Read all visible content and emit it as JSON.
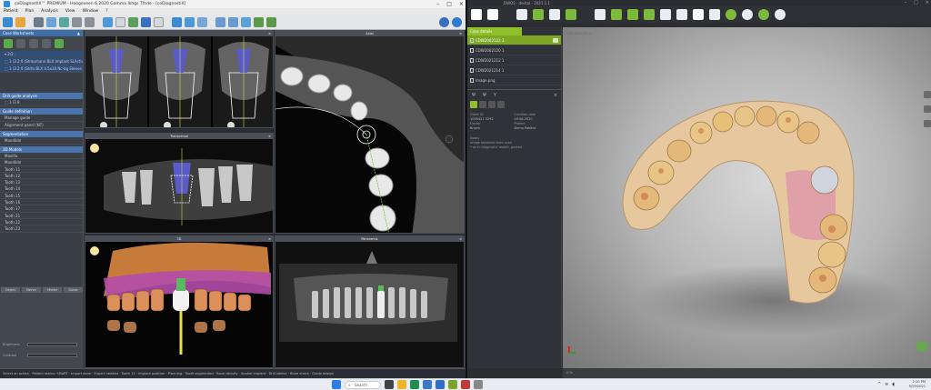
{
  "left_app": {
    "title": "coDiagnostiX™ PREMIUM - Hoogeveen 6.2020 Gamma Ikhgs Tfnde - [coDiagnostiX]",
    "menu": [
      "Patient",
      "Plan",
      "Analysis",
      "View",
      "Window",
      "?"
    ],
    "sidebar": {
      "header": "Case Worksheets",
      "pin": "▲",
      "rows": [
        {
          "label": "▾ 2/2 .",
          "selected": true
        },
        {
          "label": "  ⬚ 1 /3 2 0 (Straumann BLX Implant SLActive)",
          "selected": true
        },
        {
          "label": "  ⬚ 1 /3 2 0 (Strtn BLX 4.5x10 Nc-bg Sleeve BL)",
          "selected": true
        }
      ],
      "sections": [
        {
          "title": "Drill guide analysis",
          "rows": [
            "⬚ 1 /3 8"
          ]
        },
        {
          "title": "Guide definition",
          "rows": [
            "Manage guide",
            "Alignment panel (NT)"
          ]
        },
        {
          "title": "Segmentation",
          "rows": [
            "Mandible"
          ]
        },
        {
          "title": "3D Models",
          "rows": [
            "Maxilla",
            "Mandible",
            "Tooth 11",
            "Tooth 12",
            "Tooth 13",
            "Tooth 14",
            "Tooth 15",
            "Tooth 16",
            "Tooth 17",
            "Tooth 21",
            "Tooth 22",
            "Tooth 23"
          ]
        }
      ],
      "bottom_tabs": [
        "Object",
        "Nerve",
        "Model",
        "Guide"
      ],
      "controls": [
        "Brightness",
        "Contrast"
      ]
    },
    "views": [
      {
        "title": "",
        "kind": "sections"
      },
      {
        "title": "Axial",
        "kind": "axial"
      },
      {
        "title": "Transversal",
        "kind": "cross"
      },
      {
        "title": "3D",
        "kind": "3d"
      },
      {
        "title": "Panoramic",
        "kind": "pano"
      }
    ],
    "status": "Select an action · Patient status: SMART · Import done · Export needed · Tooth 11 · Implant position · Planning · Tooth segmented · Bone density · Spatial implant · Drill sleeve · Bone check · Guide design"
  },
  "right_app": {
    "title": "DWOS · dental - 2021.1.1",
    "panel": {
      "tab": "Case details",
      "files": [
        {
          "label": "CDW2002122 1",
          "selected": true
        },
        {
          "label": "CDW2002120 1",
          "selected": false
        },
        {
          "label": "CDW2021212 1",
          "selected": false
        },
        {
          "label": "CDW2021214 1",
          "selected": false
        },
        {
          "label": "Image.png",
          "selected": false
        }
      ],
      "info": [
        {
          "k": "Order ID",
          "v": "1009421 5292"
        },
        {
          "k": "Creation date",
          "v": "09.06.2020"
        },
        {
          "k": "Doctor",
          "v": "Brown"
        },
        {
          "k": "Patient",
          "v": "Demo Patient"
        }
      ],
      "notes_title": "Notes",
      "notes": [
        "Image obtained from scan",
        "• as in diagnostic model, guided"
      ]
    },
    "viewport_label": "CDW2002122 1",
    "status": "0 %"
  },
  "taskbar": {
    "search": "Search",
    "time": "2:10 PM",
    "date": "9/29/2021"
  },
  "colors": {
    "accent_green": "#8fbf2a",
    "accent_blue": "#3d6ea8",
    "model_color": "#e6c79e",
    "gum_color": "#e0a0a8"
  }
}
